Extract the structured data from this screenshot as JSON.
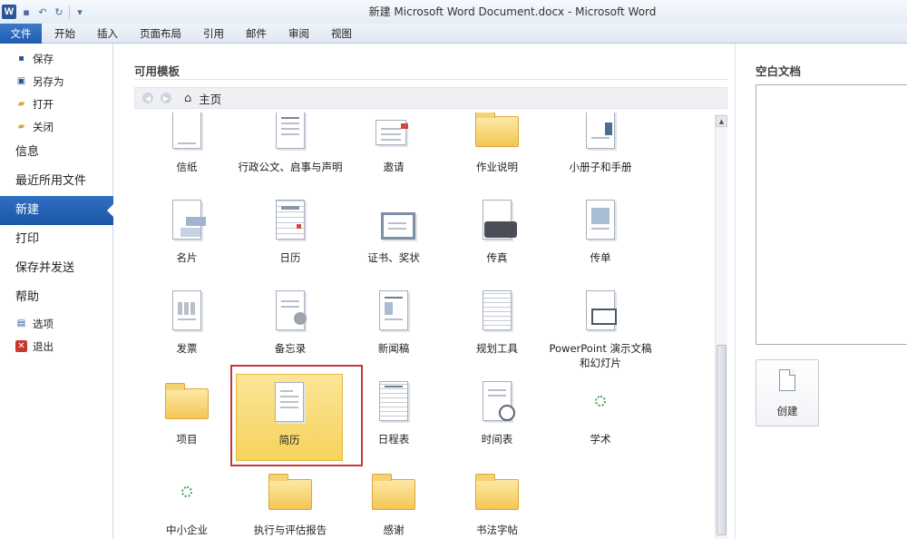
{
  "window": {
    "title": "新建 Microsoft Word Document.docx - Microsoft Word",
    "app_logo": "W"
  },
  "qat": {
    "icons": [
      "save-icon",
      "undo-icon",
      "redo-icon",
      "customize-icon"
    ]
  },
  "ribbon_tabs": [
    "文件",
    "开始",
    "插入",
    "页面布局",
    "引用",
    "邮件",
    "审阅",
    "视图"
  ],
  "nav": {
    "small_top": [
      {
        "label": "保存",
        "icon": "save-icon"
      },
      {
        "label": "另存为",
        "icon": "save-as-icon"
      },
      {
        "label": "打开",
        "icon": "open-folder-icon"
      },
      {
        "label": "关闭",
        "icon": "close-folder-icon"
      }
    ],
    "big": [
      "信息",
      "最近所用文件",
      "新建",
      "打印",
      "保存并发送",
      "帮助"
    ],
    "active": "新建",
    "small_bottom": [
      {
        "label": "选项",
        "icon": "options-icon"
      },
      {
        "label": "退出",
        "icon": "exit-icon"
      }
    ]
  },
  "templates": {
    "section_title": "可用模板",
    "path": "主页",
    "items": [
      {
        "label": "信纸",
        "icon": "stationery-icon"
      },
      {
        "label": "行政公文、启事与声明",
        "icon": "official-doc-icon"
      },
      {
        "label": "邀请",
        "icon": "invitation-icon"
      },
      {
        "label": "作业说明",
        "icon": "folder-icon"
      },
      {
        "label": "小册子和手册",
        "icon": "brochure-icon"
      },
      {
        "label": "名片",
        "icon": "business-card-icon"
      },
      {
        "label": "日历",
        "icon": "calendar-icon"
      },
      {
        "label": "证书、奖状",
        "icon": "certificate-icon"
      },
      {
        "label": "传真",
        "icon": "fax-icon"
      },
      {
        "label": "传单",
        "icon": "flyer-icon"
      },
      {
        "label": "发票",
        "icon": "invoice-icon"
      },
      {
        "label": "备忘录",
        "icon": "memo-icon"
      },
      {
        "label": "新闻稿",
        "icon": "news-icon"
      },
      {
        "label": "规划工具",
        "icon": "planner-icon"
      },
      {
        "label": "PowerPoint 演示文稿和幻灯片",
        "icon": "powerpoint-icon"
      },
      {
        "label": "项目",
        "icon": "folder-icon"
      },
      {
        "label": "简历",
        "icon": "resume-icon"
      },
      {
        "label": "日程表",
        "icon": "schedule-icon"
      },
      {
        "label": "时间表",
        "icon": "timesheet-icon"
      },
      {
        "label": "学术",
        "icon": "loading-icon"
      },
      {
        "label": "中小企业",
        "icon": "loading-icon"
      },
      {
        "label": "执行与评估报告",
        "icon": "folder-icon"
      },
      {
        "label": "感谢",
        "icon": "folder-icon"
      },
      {
        "label": "书法字帖",
        "icon": "folder-icon"
      }
    ],
    "selected": "简历"
  },
  "preview": {
    "title": "空白文档",
    "create_label": "创建"
  },
  "colors": {
    "accent": "#1e5bb0",
    "selection": "#f6d35c",
    "highlight_border": "#c0393b"
  }
}
